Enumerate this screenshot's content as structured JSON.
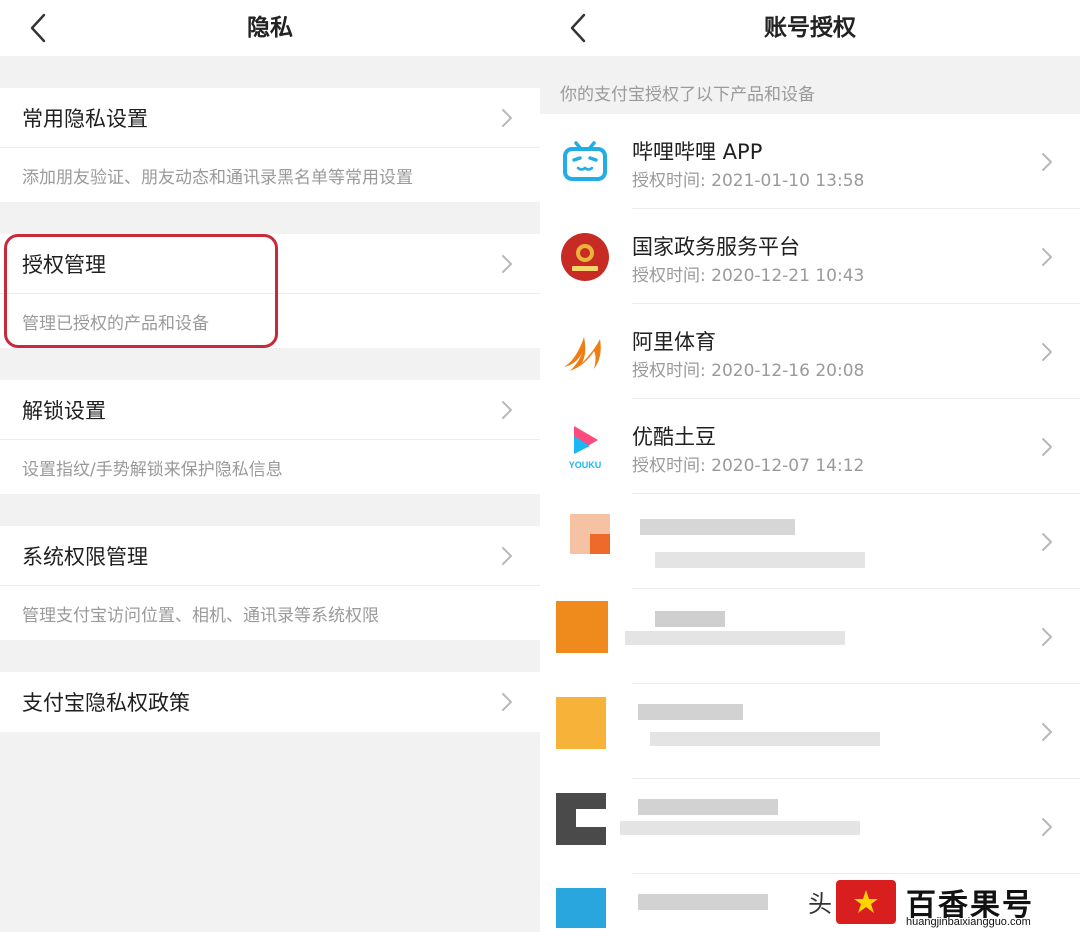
{
  "left": {
    "title": "隐私",
    "groups": [
      {
        "title": "常用隐私设置",
        "desc": "添加朋友验证、朋友动态和通讯录黑名单等常用设置"
      },
      {
        "title": "授权管理",
        "desc": "管理已授权的产品和设备"
      },
      {
        "title": "解锁设置",
        "desc": "设置指纹/手势解锁来保护隐私信息"
      },
      {
        "title": "系统权限管理",
        "desc": "管理支付宝访问位置、相机、通讯录等系统权限"
      }
    ],
    "policy": "支付宝隐私权政策"
  },
  "right": {
    "title": "账号授权",
    "hint": "你的支付宝授权了以下产品和设备",
    "items": [
      {
        "name": "哔哩哔哩 APP",
        "time": "授权时间: 2021-01-10 13:58",
        "icon": "bilibili-icon"
      },
      {
        "name": "国家政务服务平台",
        "time": "授权时间: 2020-12-21 10:43",
        "icon": "gov-emblem-icon"
      },
      {
        "name": "阿里体育",
        "time": "授权时间: 2020-12-16 20:08",
        "icon": "alisports-icon"
      },
      {
        "name": "优酷土豆",
        "time": "授权时间: 2020-12-07 14:12",
        "icon": "youku-icon"
      }
    ]
  },
  "watermark": {
    "name": "百香果号",
    "url": "huangjinbaixiangguo.com",
    "tail": "头"
  },
  "colors": {
    "highlight": "#c8293b",
    "bilibili": "#23ade5",
    "youku_pink": "#fe4a7c",
    "youku_blue": "#1ab7f2",
    "gov_red": "#c82b24",
    "alisports": "#f07c12"
  }
}
